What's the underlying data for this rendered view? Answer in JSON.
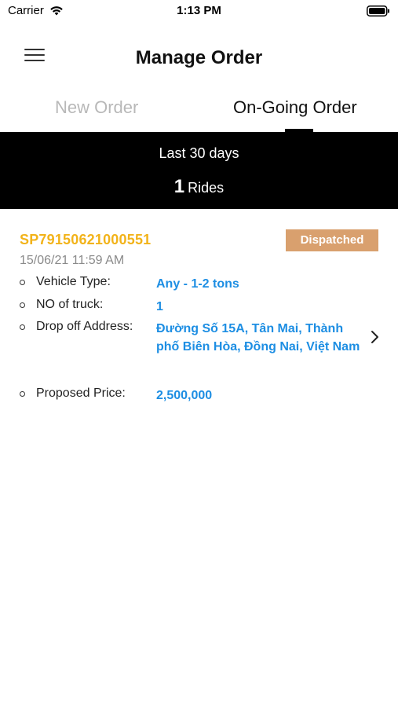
{
  "status_bar": {
    "carrier": "Carrier",
    "time": "1:13 PM",
    "wifi_icon": "wifi-icon",
    "battery_icon": "battery-icon"
  },
  "header": {
    "menu_icon": "hamburger-menu-icon",
    "title": "Manage Order"
  },
  "tabs": [
    {
      "label": "New Order",
      "active": false
    },
    {
      "label": "On-Going Order",
      "active": true
    }
  ],
  "summary": {
    "period": "Last 30 days",
    "count": "1",
    "count_label": "Rides"
  },
  "order": {
    "id": "SP79150621000551",
    "status": "Dispatched",
    "date": "15/06/21 11:59 AM",
    "details": [
      {
        "label": "Vehicle Type:",
        "value": "Any - 1-2 tons"
      },
      {
        "label": "NO of truck:",
        "value": "1"
      },
      {
        "label": "Drop off Address:",
        "value": "Đường Số 15A, Tân Mai, Thành phố Biên Hòa, Đồng Nai, Việt Nam"
      },
      {
        "label": "Proposed Price:",
        "value": "2,500,000"
      }
    ]
  },
  "colors": {
    "order_id": "#f2b31a",
    "status_badge": "#d9a06e",
    "value_text": "#1d8ee3",
    "summary_bg": "#000000"
  }
}
